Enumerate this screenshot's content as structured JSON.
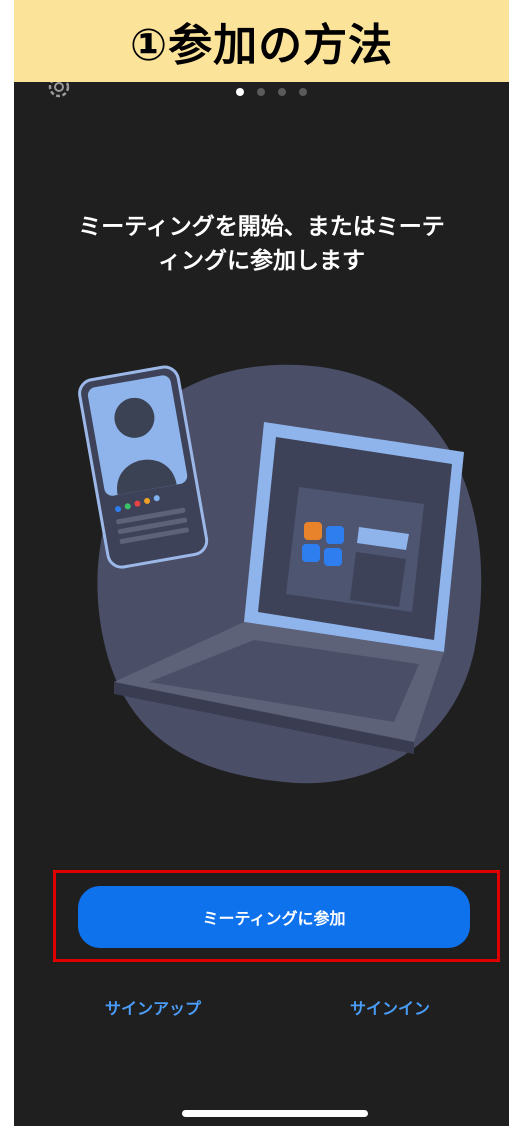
{
  "banner": {
    "title": "①参加の方法"
  },
  "onboarding": {
    "headline_line1": "ミーティングを開始、またはミーテ",
    "headline_line2": "ィングに参加します",
    "page_count": 4,
    "active_page": 1
  },
  "actions": {
    "join_label": "ミーティングに参加",
    "signup_label": "サインアップ",
    "signin_label": "サインイン"
  },
  "colors": {
    "background": "#1f1f1f",
    "primary_button": "#0e72ed",
    "link": "#4a9df8",
    "highlight_border": "#e00000",
    "banner": "#fbe39a"
  },
  "icons": [
    "gear-icon"
  ]
}
